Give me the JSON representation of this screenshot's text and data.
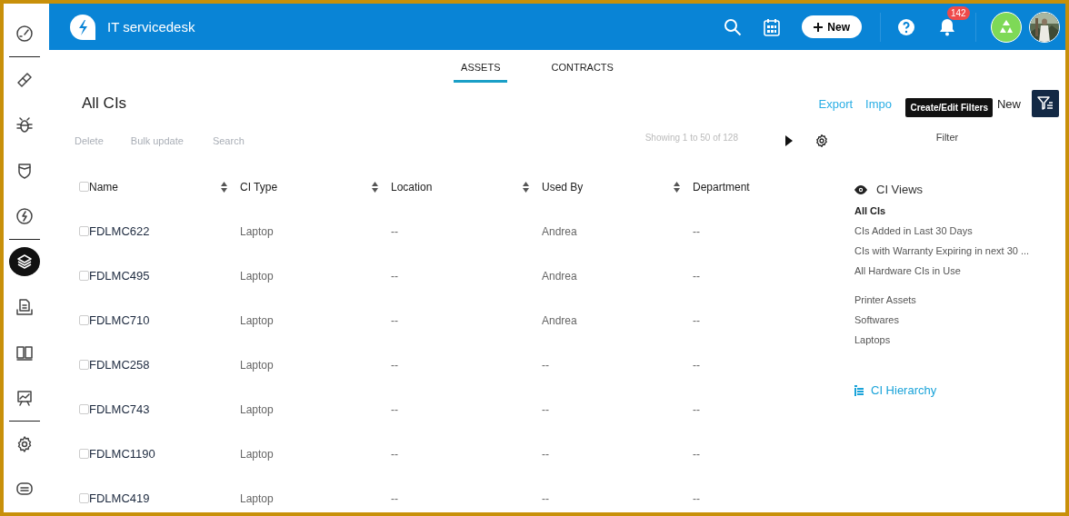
{
  "sidebar": {
    "items": [
      {
        "selected": false
      },
      {
        "selected": false
      },
      {
        "selected": false
      },
      {
        "selected": false
      },
      {
        "selected": false
      },
      {
        "selected": true
      },
      {
        "selected": false
      },
      {
        "selected": false
      },
      {
        "selected": false
      },
      {
        "selected": false
      },
      {
        "selected": false
      }
    ]
  },
  "topbar": {
    "title": "IT servicedesk",
    "new_button": "New",
    "notification_count": "142"
  },
  "tabs": [
    {
      "label": "ASSETS",
      "selected": true
    },
    {
      "label": "CONTRACTS",
      "selected": false
    }
  ],
  "page": {
    "title": "All CIs",
    "actions": [
      "Export",
      "Impo",
      "New"
    ],
    "tooltip": "Create/Edit Filters"
  },
  "toolbar": {
    "buttons": [
      {
        "label": "Delete",
        "disabled": true
      },
      {
        "label": "Bulk update",
        "disabled": true
      }
    ],
    "search": {
      "placeholder": "Search"
    },
    "pagination": "Showing 1 to 50 of 128"
  },
  "table": {
    "all_checked": false,
    "columns": [
      {
        "label": "Name",
        "sortable": true
      },
      {
        "label": "CI Type",
        "sortable": true
      },
      {
        "label": "Location",
        "sortable": true
      },
      {
        "label": "Used By",
        "sortable": true
      },
      {
        "label": "Department",
        "sortable": false
      }
    ],
    "rows": [
      {
        "checked": false,
        "cells": [
          "FDLMC622",
          "Laptop",
          "--",
          "Andrea",
          "--"
        ]
      },
      {
        "checked": false,
        "cells": [
          "FDLMC495",
          "Laptop",
          "--",
          "Andrea",
          "--"
        ]
      },
      {
        "checked": false,
        "cells": [
          "FDLMC710",
          "Laptop",
          "--",
          "Andrea",
          "--"
        ]
      },
      {
        "checked": false,
        "cells": [
          "FDLMC258",
          "Laptop",
          "--",
          "--",
          "--"
        ]
      },
      {
        "checked": false,
        "cells": [
          "FDLMC743",
          "Laptop",
          "--",
          "--",
          "--"
        ]
      },
      {
        "checked": false,
        "cells": [
          "FDLMC1190",
          "Laptop",
          "--",
          "--",
          "--"
        ]
      },
      {
        "checked": false,
        "cells": [
          "FDLMC419",
          "Laptop",
          "--",
          "--",
          "--"
        ]
      }
    ]
  },
  "side_panel": {
    "filter": "Filter",
    "views_title": "CI Views",
    "groups": [
      {
        "items": [
          {
            "label": "All CIs",
            "selected": true
          },
          {
            "label": "CIs Added in Last 30 Days",
            "selected": false
          },
          {
            "label": "CIs with Warranty Expiring in next 30 ...",
            "selected": false
          },
          {
            "label": "All Hardware CIs in Use",
            "selected": false
          }
        ]
      },
      {
        "items": [
          {
            "label": "Printer Assets",
            "selected": false
          },
          {
            "label": "Softwares",
            "selected": false
          },
          {
            "label": "Laptops",
            "selected": false
          }
        ]
      }
    ],
    "hierarchy": "CI Hierarchy"
  }
}
